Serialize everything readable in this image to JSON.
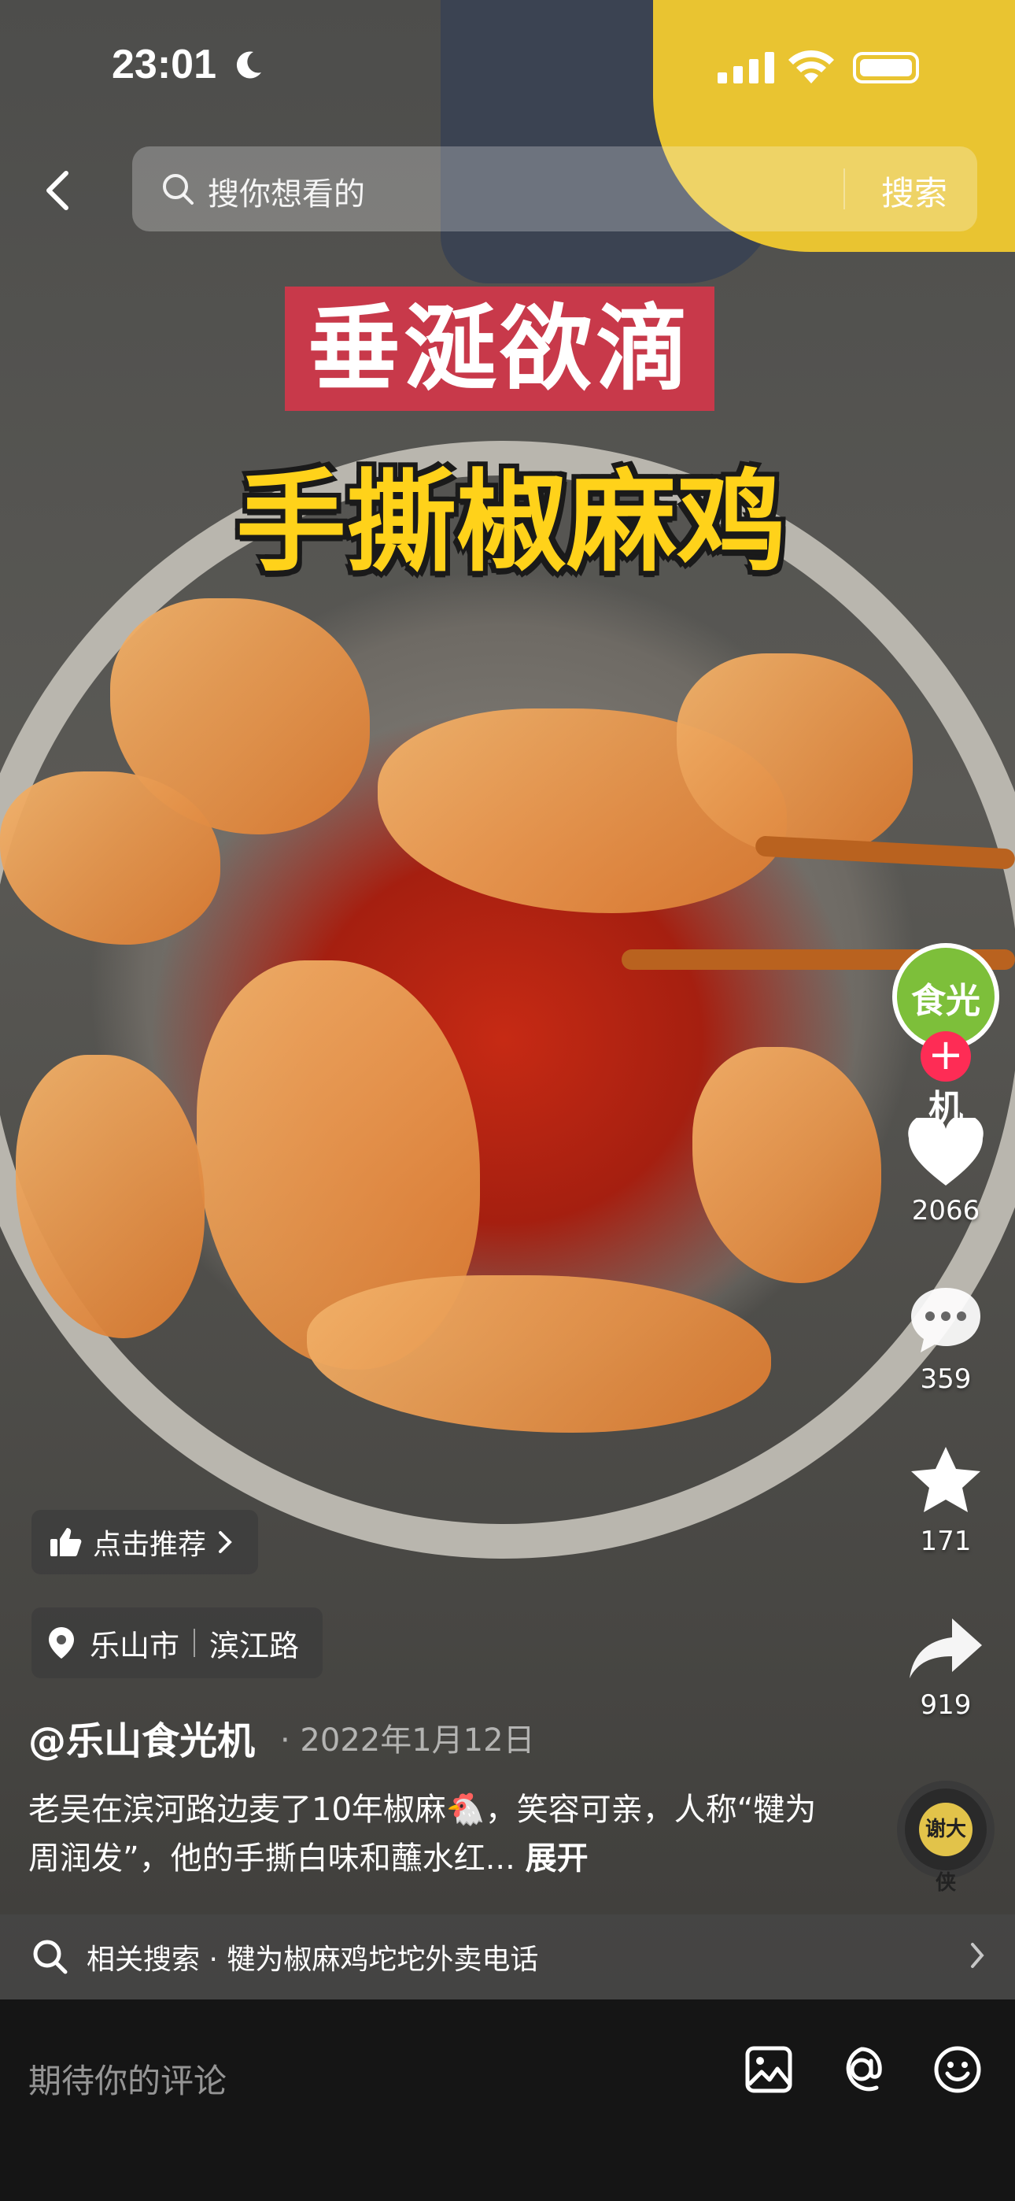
{
  "status_bar": {
    "time": "23:01"
  },
  "search": {
    "placeholder": "搜你想看的",
    "button_label": "搜索"
  },
  "captions": {
    "line1": "垂涎欲滴",
    "line2": "手撕椒麻鸡"
  },
  "creator": {
    "avatar_text": "食光机"
  },
  "actions": {
    "likes": "2066",
    "comments": "359",
    "favorites": "171",
    "shares": "919"
  },
  "recommend_label": "点击推荐",
  "location": {
    "city": "乐山市",
    "place": "滨江路"
  },
  "post": {
    "author": "@乐山食光机",
    "date": "· 2022年1月12日",
    "description": "老吴在滨河路边麦了10年椒麻🐔，笑容可亲，人称“犍为周润发”，他的手撕白味和蘸水红...",
    "expand_label": "展开"
  },
  "related_search": {
    "label": "相关搜索 · 犍为椒麻鸡坨坨外卖电话"
  },
  "music_disc": {
    "text": "谢大侠"
  },
  "comment_bar": {
    "placeholder": "期待你的评论"
  }
}
